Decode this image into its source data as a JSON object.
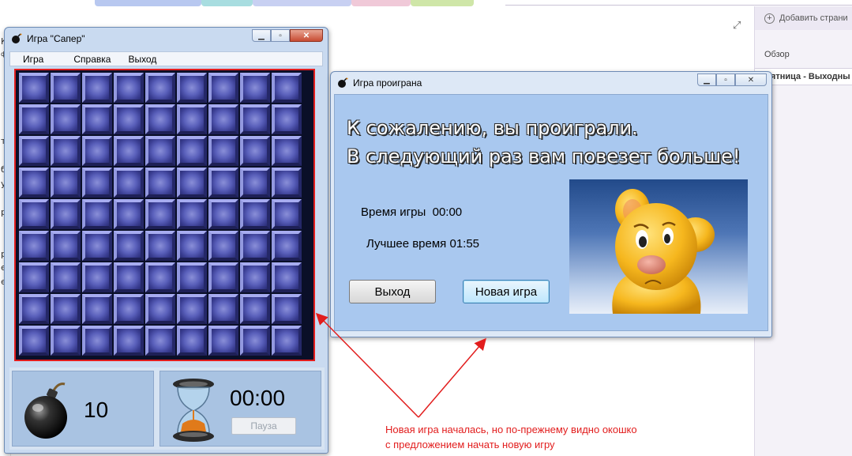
{
  "minesweeper": {
    "title": "Игра \"Сапер\"",
    "menu": [
      "Игра",
      "Справка",
      "Выход"
    ],
    "mines_left": "10",
    "timer": "00:00",
    "pause_label": "Пауза",
    "grid_rows": 9,
    "grid_cols": 9
  },
  "lost_dialog": {
    "title": "Игра проиграна",
    "message_line1": "К сожалению, вы проиграли.",
    "message_line2": "В следующий раз вам повезет больше!",
    "game_time_label": "Время игры",
    "game_time_value": "00:00",
    "best_time_label": "Лучшее время",
    "best_time_value": "01:55",
    "exit_label": "Выход",
    "new_game_label": "Новая игра"
  },
  "background_app": {
    "add_page_label": "Добавить страни",
    "overview_label": "Обзор",
    "page_item_label": "Пятница - Выходны",
    "left_strip_chars": [
      "К",
      "ф",
      "т",
      "б",
      "у",
      "р",
      "р",
      "е",
      "е"
    ]
  },
  "annotation": {
    "line1": "Новая игра началась, но по-прежнему видно окошко",
    "line2": "с предложением начать новую игру",
    "color": "#e21d1d"
  }
}
